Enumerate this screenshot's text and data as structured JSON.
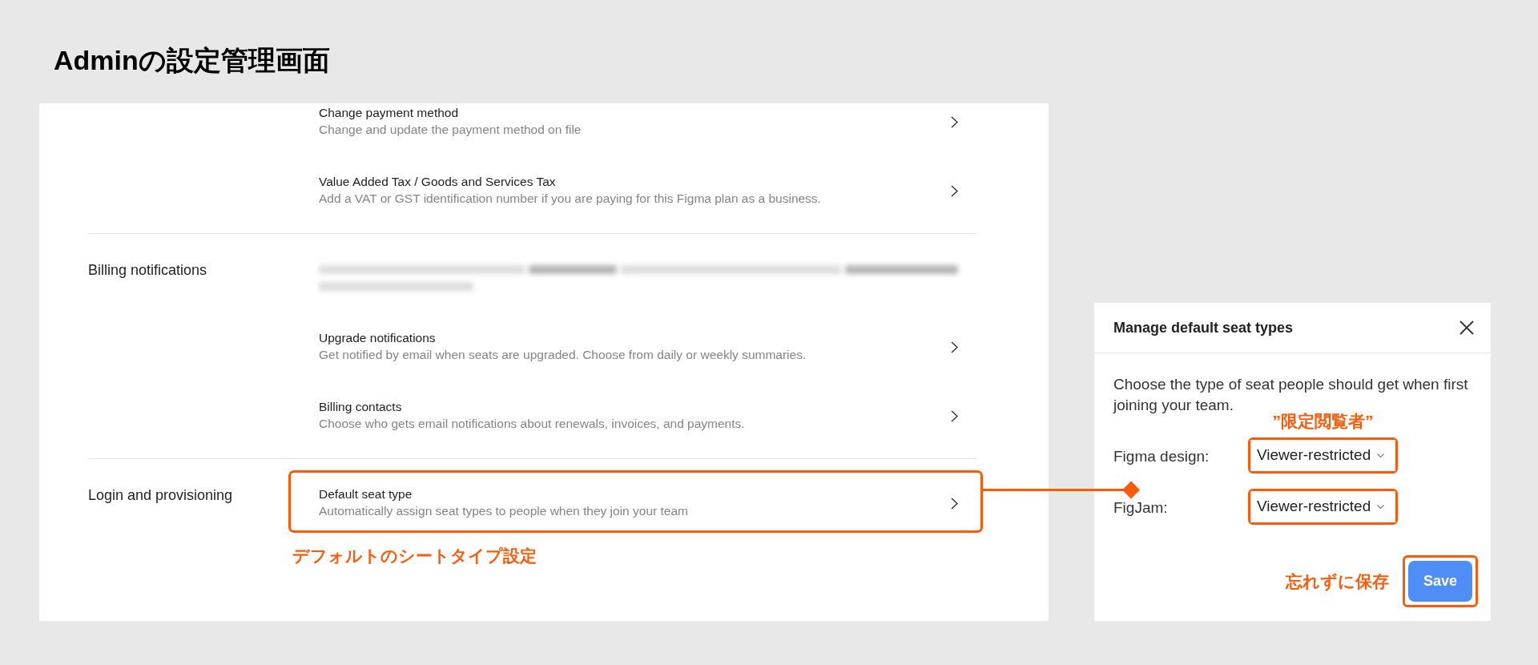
{
  "page": {
    "title": "Adminの設定管理画面"
  },
  "settings": {
    "sections": [
      {
        "items": [
          {
            "kind": "link",
            "title": "Change payment method",
            "description": "Change and update the payment method on file",
            "highlighted": false
          },
          {
            "kind": "link",
            "title": "Value Added Tax / Goods and Services Tax",
            "description": "Add a VAT or GST identification number if you are paying for this Figma plan as a business.",
            "highlighted": false
          }
        ]
      },
      {
        "label": "Billing notifications",
        "items": [
          {
            "kind": "redacted",
            "highlighted": false
          },
          {
            "kind": "link",
            "title": "Upgrade notifications",
            "description": "Get notified by email when seats are upgraded. Choose from daily or weekly summaries.",
            "highlighted": false
          },
          {
            "kind": "link",
            "title": "Billing contacts",
            "description": "Choose who gets email notifications about renewals, invoices, and payments.",
            "highlighted": false
          }
        ]
      },
      {
        "label": "Login and provisioning",
        "items": [
          {
            "kind": "link",
            "title": "Default seat type",
            "description": "Automatically assign seat types to people when they join your team",
            "highlighted": true,
            "annotation": "デフォルトのシートタイプ設定"
          }
        ]
      }
    ]
  },
  "connector": true,
  "dialog": {
    "title": "Manage default seat types",
    "description": "Choose the type of seat people should get when first joining your team.",
    "fields": [
      {
        "label": "Figma design:",
        "value": "Viewer-restricted",
        "highlighted": true,
        "annotation": "”限定閲覧者”"
      },
      {
        "label": "FigJam:",
        "value": "Viewer-restricted",
        "highlighted": true
      }
    ],
    "save_button": {
      "label": "Save",
      "highlighted": true,
      "annotation": "忘れずに保存"
    }
  }
}
